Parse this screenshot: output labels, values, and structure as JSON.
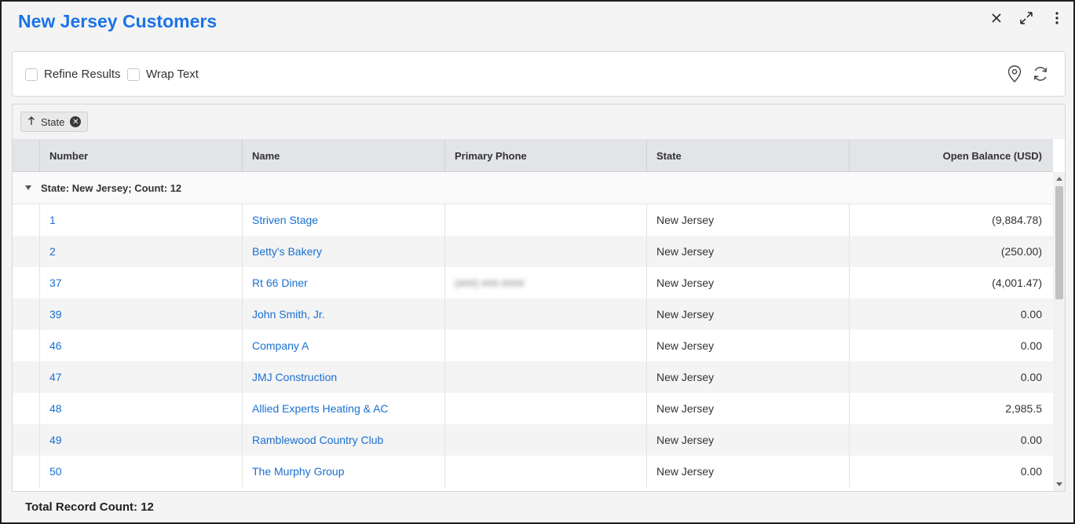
{
  "window": {
    "title": "New Jersey Customers"
  },
  "toolbar": {
    "refine_label": "Refine Results",
    "wrap_label": "Wrap Text",
    "refine_checked": false,
    "wrap_checked": false
  },
  "grouping": {
    "chip_label": "State",
    "sort_icon": "arrow-up-icon"
  },
  "columns": {
    "number": "Number",
    "name": "Name",
    "phone": "Primary Phone",
    "state": "State",
    "balance": "Open Balance (USD)"
  },
  "group": {
    "label": "State: New Jersey; Count: 12"
  },
  "rows": [
    {
      "number": "1",
      "name": "Striven Stage",
      "phone": "",
      "state": "New Jersey",
      "balance": "(9,884.78)"
    },
    {
      "number": "2",
      "name": "Betty's Bakery",
      "phone": "",
      "state": "New Jersey",
      "balance": "(250.00)"
    },
    {
      "number": "37",
      "name": "Rt 66 Diner",
      "phone": "(###) ###-####",
      "state": "New Jersey",
      "balance": "(4,001.47)"
    },
    {
      "number": "39",
      "name": "John Smith, Jr.",
      "phone": "",
      "state": "New Jersey",
      "balance": "0.00"
    },
    {
      "number": "46",
      "name": "Company A",
      "phone": "",
      "state": "New Jersey",
      "balance": "0.00"
    },
    {
      "number": "47",
      "name": "JMJ Construction",
      "phone": "",
      "state": "New Jersey",
      "balance": "0.00"
    },
    {
      "number": "48",
      "name": "Allied Experts Heating & AC",
      "phone": "",
      "state": "New Jersey",
      "balance": "2,985.5"
    },
    {
      "number": "49",
      "name": "Ramblewood Country Club",
      "phone": "",
      "state": "New Jersey",
      "balance": "0.00"
    },
    {
      "number": "50",
      "name": "The Murphy Group",
      "phone": "",
      "state": "New Jersey",
      "balance": "0.00"
    }
  ],
  "footer": {
    "total_label": "Total Record Count: 12"
  },
  "colors": {
    "accent": "#1a73e8",
    "link": "#1a6fd1",
    "header_bg": "#e2e4e8"
  }
}
